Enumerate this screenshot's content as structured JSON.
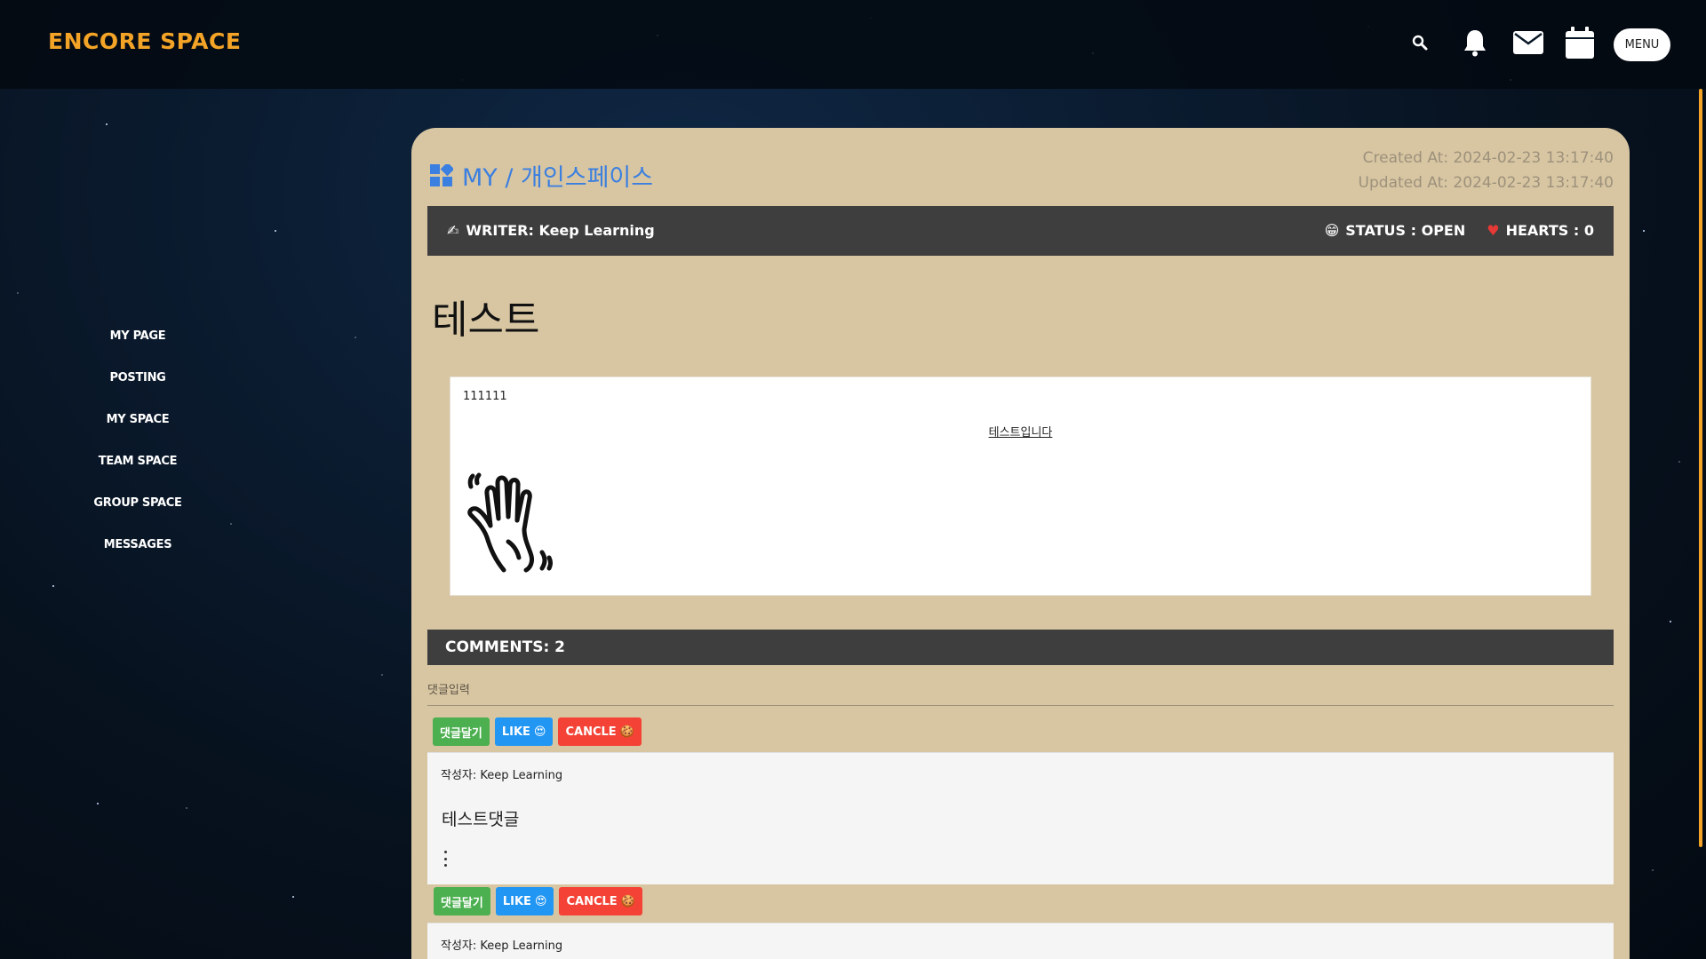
{
  "brand": "ENCORE SPACE",
  "topbar": {
    "icons": [
      "search-icon",
      "bell-icon",
      "mail-icon",
      "calendar-icon"
    ],
    "menu_label": "MENU"
  },
  "sidebar": {
    "items": [
      {
        "label": "MY PAGE"
      },
      {
        "label": "POSTING"
      },
      {
        "label": "MY SPACE"
      },
      {
        "label": "TEAM SPACE"
      },
      {
        "label": "GROUP SPACE"
      },
      {
        "label": "MESSAGES"
      }
    ]
  },
  "post": {
    "breadcrumb": "MY / 개인스페이스",
    "created_at": "Created At: 2024-02-23 13:17:40",
    "updated_at": "Updated At: 2024-02-23 13:17:40",
    "writer": "WRITER: Keep Learning",
    "status": "STATUS : OPEN",
    "hearts": "HEARTS : 0",
    "title": "테스트",
    "body_line": "111111",
    "body_link": "테스트입니다"
  },
  "comments": {
    "header": "COMMENTS: 2",
    "input_placeholder": "댓글입력",
    "reply_label": "댓글달기",
    "like_label": "LIKE",
    "cancel_label": "CANCLE",
    "items": [
      {
        "author": "작성자: Keep Learning",
        "text": "테스트댓글"
      },
      {
        "author": "작성자: Keep Learning",
        "text": ""
      }
    ]
  },
  "colors": {
    "brand": "#f3a326",
    "card": "#d8c6a2",
    "bar": "#3e3e3e",
    "breadcrumb": "#3b7fe0",
    "green": "#4caf50",
    "blue": "#2196f3",
    "red": "#f44336"
  }
}
